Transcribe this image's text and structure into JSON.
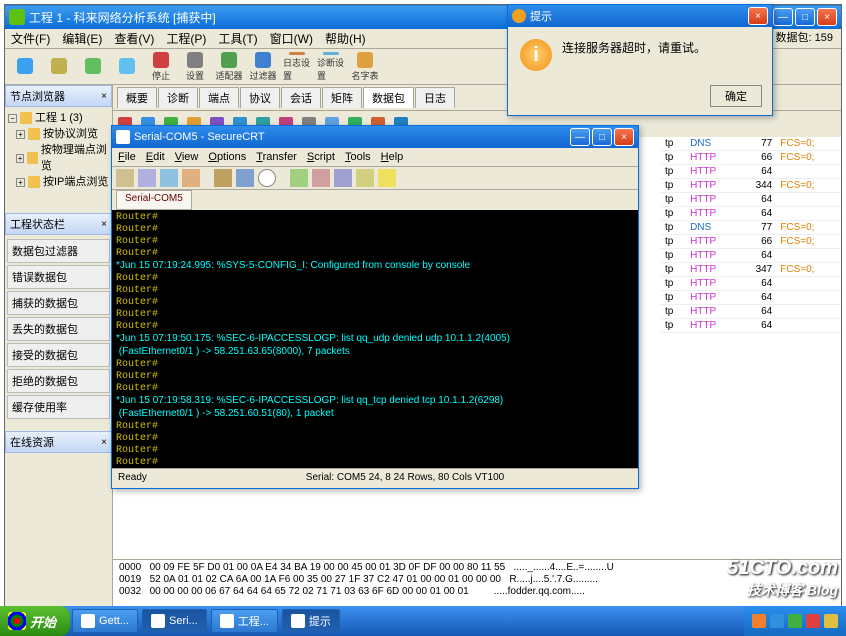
{
  "mainApp": {
    "title": "工程 1 - 科来网络分析系统 [捕获中]",
    "menus": [
      "文件(F)",
      "编辑(E)",
      "查看(V)",
      "工程(P)",
      "工具(T)",
      "窗口(W)",
      "帮助(H)"
    ],
    "toolbar": [
      {
        "lbl": "",
        "c": "#3aa0f0"
      },
      {
        "lbl": "",
        "c": "#c0b050"
      },
      {
        "lbl": "",
        "c": "#60c060"
      },
      {
        "lbl": "",
        "c": "#60c0f0"
      },
      {
        "lbl": "停止",
        "c": "#d04040"
      },
      {
        "lbl": "设置",
        "c": "#808080"
      },
      {
        "lbl": "适配器",
        "c": "#50a050"
      },
      {
        "lbl": "过滤器",
        "c": "#4080d0"
      },
      {
        "lbl": "日志设置",
        "c": "#d08040"
      },
      {
        "lbl": "诊断设置",
        "c": "#60b0e0"
      },
      {
        "lbl": "名字表",
        "c": "#e0a040"
      }
    ],
    "pktCount": "数据包: 159",
    "tabs": [
      "概要",
      "诊断",
      "端点",
      "协议",
      "会话",
      "矩阵",
      "数据包",
      "日志"
    ],
    "activeTab": "数据包",
    "miniIcons": [
      "#d04040",
      "#3a90e0",
      "#40b040",
      "#e0a030",
      "#8050c0",
      "#3090d0",
      "#30a0a0",
      "#c04080",
      "#808080",
      "#60a0e0",
      "#30b060",
      "#d06030",
      "#2080c0"
    ]
  },
  "leftPanel": {
    "nodeBrowserTitle": "节点浏览器",
    "tree": [
      {
        "expand": "−",
        "label": "工程 1 (3)"
      },
      {
        "expand": "+",
        "label": "按协议浏览"
      },
      {
        "expand": "+",
        "label": "按物理端点浏览"
      },
      {
        "expand": "+",
        "label": "按IP端点浏览"
      }
    ],
    "statsTitle": "工程状态栏",
    "stats": [
      "数据包过滤器",
      "错误数据包",
      "捕获的数据包",
      "丢失的数据包",
      "接受的数据包",
      "拒绝的数据包",
      "缓存使用率"
    ],
    "onlineTitle": "在线资源"
  },
  "gridRows": [
    {
      "p": "DNS",
      "n": "77",
      "f": "FCS=0;"
    },
    {
      "p": "HTTP",
      "n": "66",
      "f": "FCS=0;"
    },
    {
      "p": "HTTP",
      "n": "64",
      "f": ""
    },
    {
      "p": "HTTP",
      "n": "344",
      "f": "FCS=0;"
    },
    {
      "p": "HTTP",
      "n": "64",
      "f": ""
    },
    {
      "p": "HTTP",
      "n": "64",
      "f": ""
    },
    {
      "p": "DNS",
      "n": "77",
      "f": "FCS=0;"
    },
    {
      "p": "HTTP",
      "n": "66",
      "f": "FCS=0;"
    },
    {
      "p": "HTTP",
      "n": "64",
      "f": ""
    },
    {
      "p": "HTTP",
      "n": "347",
      "f": "FCS=0;"
    },
    {
      "p": "HTTP",
      "n": "64",
      "f": ""
    },
    {
      "p": "HTTP",
      "n": "64",
      "f": ""
    },
    {
      "p": "HTTP",
      "n": "64",
      "f": ""
    },
    {
      "p": "HTTP",
      "n": "64",
      "f": ""
    }
  ],
  "hex": {
    "l1": "0000   00 09 FE 5F D0 01 00 0A E4 34 BA 19 00 00 45 00 01 3D 0F DF 00 00 80 11 55   ....._......4....E..=........U",
    "l2": "0019   52 0A 01 01 02 CA 6A 00 1A F6 00 35 00 27 1F 37 C2 47 01 00 00 01 00 00 00   R.....j....5.'.7.G.........",
    "l3": "0032   00 00 00 00 06 67 64 64 64 65 72 02 71 71 03 63 6F 6D 00 00 01 00 01         .....fodder.qq.com.....    "
  },
  "crt": {
    "title": "Serial-COM5 - SecureCRT",
    "menus": [
      "File",
      "Edit",
      "View",
      "Options",
      "Transfer",
      "Script",
      "Tools",
      "Help"
    ],
    "tab": "Serial-COM5",
    "lines": [
      "Router#",
      "Router#",
      "Router#",
      "Router#",
      "*Jun 15 07:19:24.995: %SYS-5-CONFIG_I: Configured from console by console",
      "Router#",
      "Router#",
      "Router#",
      "Router#",
      "Router#",
      "*Jun 15 07:19:50.175: %SEC-6-IPACCESSLOGP: list qq_udp denied udp 10.1.1.2(4005)",
      " (FastEthernet0/1 ) -> 58.251.63.65(8000), 7 packets",
      "Router#",
      "Router#",
      "Router#",
      "*Jun 15 07:19:58.319: %SEC-6-IPACCESSLOGP: list qq_tcp denied tcp 10.1.1.2(6298)",
      " (FastEthernet0/1 ) -> 58.251.60.51(80), 1 packet",
      "Router#",
      "Router#",
      "Router#",
      "Router#",
      "Router#",
      "Router#"
    ],
    "statusL": "Ready",
    "statusR": "Serial: COM5   24,   8  24 Rows,  80 Cols VT100"
  },
  "dialog": {
    "title": "提示",
    "message": "连接服务器超时，请重试。",
    "ok": "确定"
  },
  "taskbar": {
    "start": "开始",
    "items": [
      {
        "label": "Gett..."
      },
      {
        "label": "Seri...",
        "active": true
      },
      {
        "label": "工程..."
      },
      {
        "label": "提示",
        "active": true
      }
    ]
  },
  "watermark": {
    "line1": "51CTO.com",
    "line2": "技术博客  Blog"
  }
}
